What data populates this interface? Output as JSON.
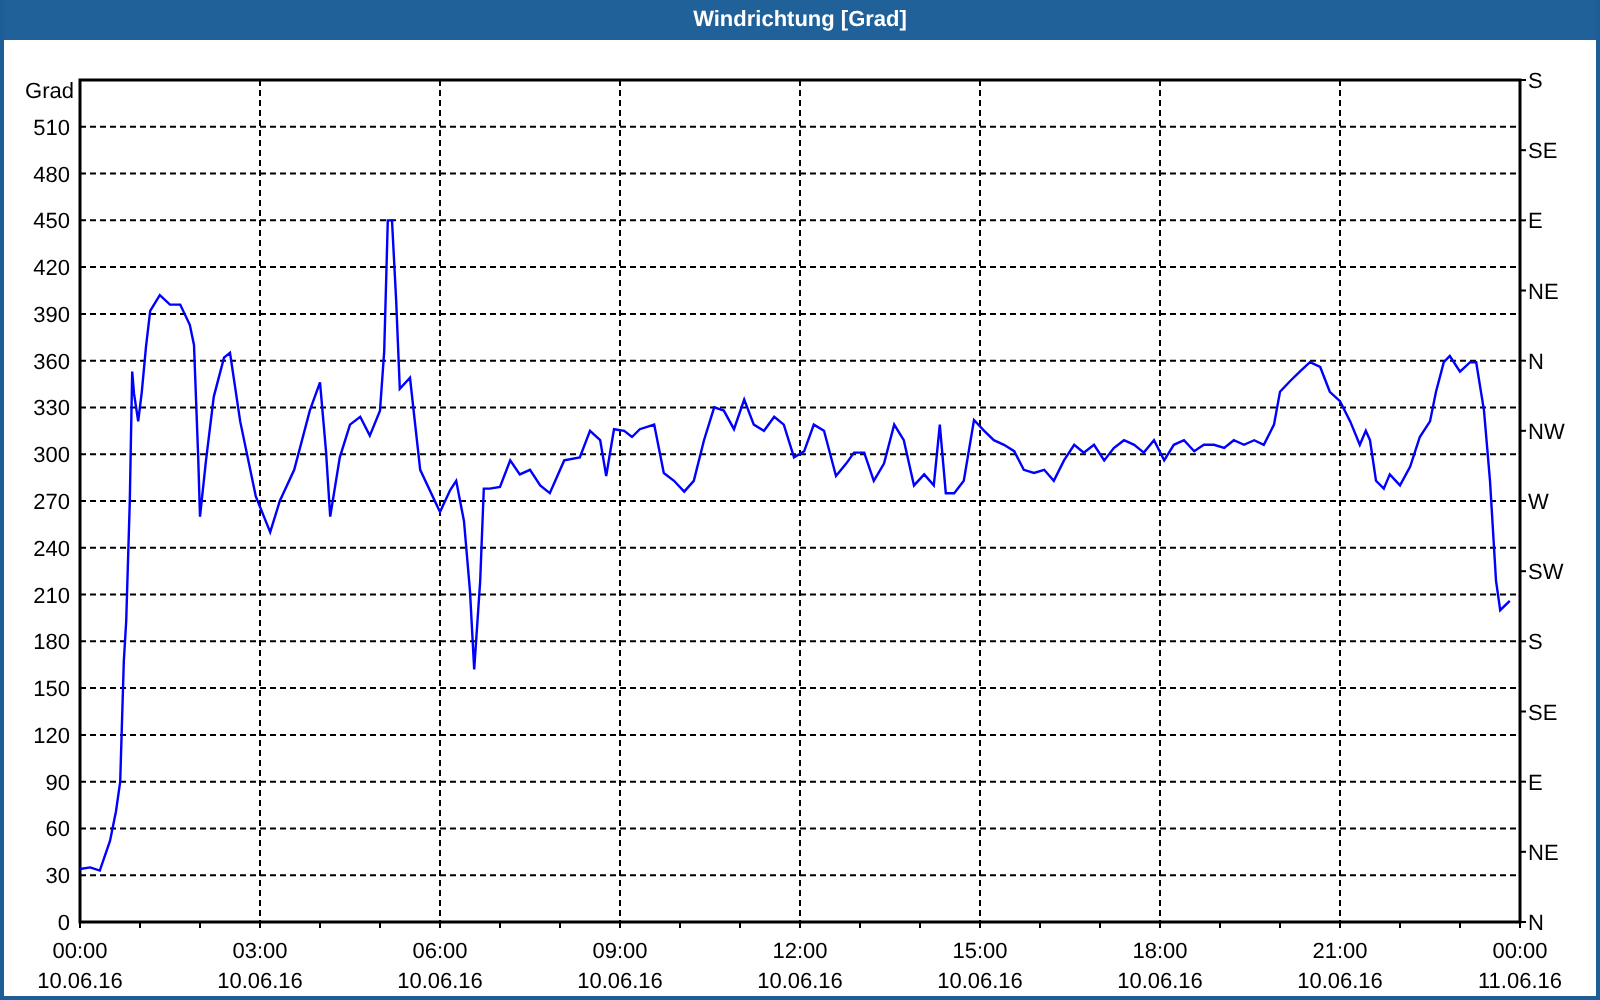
{
  "window": {
    "title": "Windrichtung [Grad]"
  },
  "chart": {
    "chart_data": {
      "type": "line",
      "grid": true,
      "ylabel": "Grad",
      "xlim": [
        0,
        24
      ],
      "ylim": [
        0,
        540
      ],
      "yticks": [
        0,
        30,
        60,
        90,
        120,
        150,
        180,
        210,
        240,
        270,
        300,
        330,
        360,
        390,
        420,
        450,
        480,
        510
      ],
      "xticks": [
        {
          "value": 0,
          "label": "00:00"
        },
        {
          "value": 3,
          "label": "03:00"
        },
        {
          "value": 6,
          "label": "06:00"
        },
        {
          "value": 9,
          "label": "09:00"
        },
        {
          "value": 12,
          "label": "12:00"
        },
        {
          "value": 15,
          "label": "15:00"
        },
        {
          "value": 18,
          "label": "18:00"
        },
        {
          "value": 21,
          "label": "21:00"
        },
        {
          "value": 24,
          "label": "00:00"
        }
      ],
      "x": [
        0,
        0.17,
        0.33,
        0.5,
        0.6,
        0.67,
        0.73,
        0.77,
        0.83,
        0.87,
        0.9,
        0.97,
        1.03,
        1.1,
        1.17,
        1.33,
        1.5,
        1.67,
        1.83,
        1.9,
        1.97,
        2,
        2.1,
        2.23,
        2.4,
        2.5,
        2.67,
        2.93,
        3.17,
        3.33,
        3.57,
        3.83,
        4,
        4.1,
        4.17,
        4.33,
        4.5,
        4.67,
        4.83,
        5,
        5.07,
        5.13,
        5.2,
        5.27,
        5.33,
        5.5,
        5.67,
        6,
        6.17,
        6.27,
        6.4,
        6.5,
        6.57,
        6.67,
        6.73,
        6.83,
        7,
        7.17,
        7.33,
        7.5,
        7.67,
        7.83,
        8.07,
        8.33,
        8.5,
        8.67,
        8.77,
        8.9,
        9.07,
        9.2,
        9.33,
        9.57,
        9.73,
        9.9,
        10.07,
        10.23,
        10.4,
        10.57,
        10.73,
        10.9,
        11.07,
        11.23,
        11.4,
        11.57,
        11.73,
        11.9,
        12.07,
        12.23,
        12.4,
        12.6,
        12.77,
        12.9,
        13.07,
        13.23,
        13.4,
        13.57,
        13.73,
        13.9,
        14.07,
        14.23,
        14.33,
        14.43,
        14.57,
        14.73,
        14.9,
        15.07,
        15.23,
        15.4,
        15.57,
        15.73,
        15.9,
        16.07,
        16.23,
        16.4,
        16.57,
        16.73,
        16.9,
        17.07,
        17.23,
        17.4,
        17.57,
        17.73,
        17.9,
        18.07,
        18.23,
        18.4,
        18.57,
        18.73,
        18.9,
        19.07,
        19.23,
        19.4,
        19.57,
        19.73,
        19.9,
        20,
        20.17,
        20.33,
        20.5,
        20.67,
        20.83,
        21,
        21.17,
        21.33,
        21.43,
        21.5,
        21.6,
        21.73,
        21.83,
        22,
        22.17,
        22.33,
        22.5,
        22.6,
        22.73,
        22.83,
        23,
        23.17,
        23.27,
        23.4,
        23.5,
        23.6,
        23.67,
        23.83
      ],
      "series": [
        {
          "color": "#0000ff",
          "values": [
            34,
            35,
            33,
            52,
            71,
            90,
            167,
            193,
            270,
            353,
            339,
            321,
            340,
            369,
            392,
            402,
            396,
            396,
            383,
            370,
            298,
            260,
            296,
            337,
            362,
            365,
            321,
            273,
            250,
            270,
            290,
            328,
            346,
            302,
            260,
            298,
            319,
            324,
            312,
            328,
            366,
            450,
            450,
            398,
            342,
            349,
            290,
            263,
            277,
            283,
            257,
            212,
            162,
            219,
            278,
            278,
            279,
            296,
            287,
            290,
            280,
            275,
            296,
            298,
            315,
            309,
            286,
            316,
            315,
            311,
            316,
            319,
            288,
            283,
            276,
            283,
            309,
            330,
            328,
            316,
            335,
            319,
            315,
            324,
            319,
            298,
            302,
            319,
            315,
            286,
            294,
            301,
            301,
            283,
            294,
            319,
            309,
            280,
            287,
            280,
            319,
            275,
            275,
            283,
            322,
            315,
            309,
            306,
            302,
            290,
            288,
            290,
            283,
            296,
            306,
            301,
            306,
            296,
            304,
            309,
            306,
            301,
            309,
            296,
            306,
            309,
            302,
            306,
            306,
            304,
            309,
            306,
            309,
            306,
            319,
            340,
            347,
            353,
            359,
            356,
            340,
            334,
            321,
            306,
            315,
            309,
            283,
            278,
            287,
            280,
            292,
            311,
            321,
            340,
            359,
            363,
            353,
            359,
            359,
            328,
            283,
            219,
            200,
            206
          ]
        }
      ]
    },
    "x_axis_dates": [
      "10.06.16",
      "10.06.16",
      "10.06.16",
      "10.06.16",
      "10.06.16",
      "10.06.16",
      "10.06.16",
      "10.06.16",
      "11.06.16"
    ],
    "right_axis_labels": [
      "S",
      "SE",
      "E",
      "NE",
      "N",
      "NW",
      "W",
      "SW",
      "S",
      "SE",
      "E",
      "NE",
      "N"
    ]
  }
}
